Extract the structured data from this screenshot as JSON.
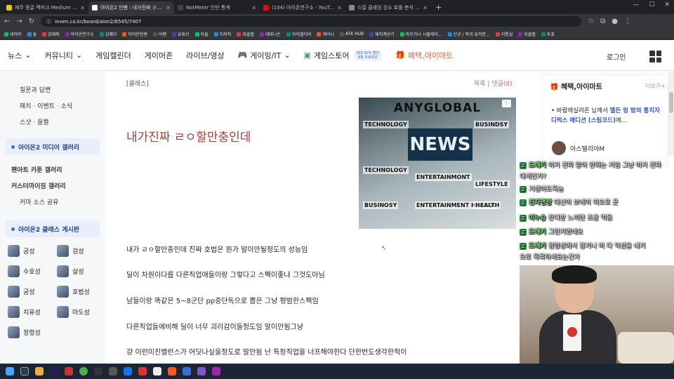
{
  "browser": {
    "tabs": [
      {
        "title": "제주 중글 멕마크 Medium | 마",
        "active": false,
        "color": "#f5c518"
      },
      {
        "title": "아이온2 인벤 : 내가진짜 ㄹㅇ할",
        "active": true,
        "color": "#ffffff"
      },
      {
        "title": "NotMeter 인턴 통계",
        "active": false,
        "color": "#444444"
      },
      {
        "title": "(104) 아이온연구소 - YouTube",
        "active": false,
        "color": "#ff0000"
      },
      {
        "title": "스킬 클래엄 강소 효플 분석 · 사",
        "active": false,
        "color": "#888888"
      }
    ],
    "new_tab": "+",
    "url": "inven.co.kr/board/aion2/6545/7407",
    "bookmarks": [
      "네이버",
      "숲",
      "김혜파",
      "아이온연구소",
      "김혜다",
      "아이온인벤",
      "아펜",
      "유튜브",
      "아들",
      "치지직",
      "위클랩",
      "데테니슨",
      "아이엘디비",
      "케이니",
      "ATK HUB",
      "재직계산기",
      "마르가나 시뮬레이...",
      "신규 / 복귀 유저분...",
      "지통실",
      "위클랩",
      "투표"
    ]
  },
  "nav": {
    "items": [
      "뉴스",
      "커뮤니티",
      "게임캘린더",
      "게이머존",
      "라이브/영상",
      "게이밍/IT",
      "게임스토어",
      "혜택,아이마트"
    ],
    "promo_line1": "최대 90% 할인",
    "promo_line2": "8월 프로모션",
    "login": "로그인"
  },
  "sidebar": {
    "top_items": [
      "질문과 답변",
      "패치 · 이벤트 · 소식",
      "스샷 · 움짤"
    ],
    "media_header": "아이온2 미디어 갤러리",
    "media_items": [
      "팬아트 카툰 갤러리",
      "커스터마이징 갤러리",
      "커마 소스 공유"
    ],
    "class_header": "아이온2 클래스 게시판",
    "classes": [
      "궁성",
      "검성",
      "수호성",
      "살성",
      "궁성",
      "호법성",
      "치유성",
      "마도성",
      "정령성"
    ]
  },
  "article": {
    "category": "[클래스]",
    "list_link": "목록",
    "comment_link": "댓글",
    "comment_count": "(8)",
    "title": "내가진짜 ㄹㅇ할만충인데",
    "paragraphs": [
      "내가 ㄹㅇ할만충인데 진짜 호법은 뭔가 말이안될정도의 성능임",
      "딜이 차원이다름 다른직업애들이랑 그렇다고 스펙이좋냐 그것도아님",
      "남들이랑 똑같은 5~8군단 pp중단독으로 뽑은 그냥 평범한스펙임",
      "다른직업들에비해 딜이 너무 괴리감이들정도임 말이안됨그냥",
      "걍 이런미친밸런스가 어딧나싶을정도로 말안됨 난 특정직업을 너프해야한다 단한번도생각한적이"
    ]
  },
  "ad": {
    "brand": "ANYGLOBAL",
    "headline": "NEWS",
    "labels": [
      "TECHNOLOGY",
      "BUSINDSY",
      "TECHNOLOGY",
      "ENTERTAINMONT",
      "LIFESTYLE",
      "BUSINOSY",
      "ENTERTAINMENT HEALTH",
      "HEALTH"
    ]
  },
  "right": {
    "box_title": "혜택,아이마트",
    "box_more": "더보기+",
    "notice_prefix": "바람에실려온 님께서 ",
    "notice_link": "엘든 링 밤의 통치자 디럭스 에디션 (스팀코드)",
    "notice_suffix": "에...",
    "profile_name": "아스텔리아M"
  },
  "chat": [
    {
      "badge": "Z",
      "name": "도깨기",
      "text": "이거 진짜 말이 안되는 거임 그냥 이거 진짜"
    },
    {
      "badge": "",
      "name": "",
      "text": "대세인가?"
    },
    {
      "badge": "Z",
      "name": "",
      "text": "기생이도둑놈"
    },
    {
      "badge": "Z",
      "name": "진자명방",
      "text": "대신이 보네이 혀오로 곳"
    },
    {
      "badge": "Z",
      "name": "이누승",
      "text": "잔디밭 느끼면 조금 먹음"
    },
    {
      "badge": "Z",
      "name": "도깨기",
      "text": "그런거였네요"
    },
    {
      "badge": "Z",
      "name": "도깨기",
      "text": "정령성에서 정기니 버 다 딕션을 내거"
    },
    {
      "badge": "",
      "name": "",
      "text": "으로 목록하세요는건가"
    }
  ],
  "colors": {
    "title": "#a0413a",
    "nav_accent": "#1c3f94",
    "chat_badge": "#1e8f3e"
  }
}
